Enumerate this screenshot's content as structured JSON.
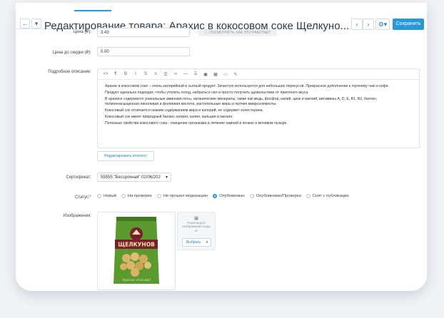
{
  "header": {
    "title": "Редактирование товара: Арахис в кокосовом соке Щелкуно...",
    "back_icon": "back-arrow-icon",
    "menu_icon": "chevron-down-icon",
    "save_label": "Сохранить"
  },
  "form": {
    "price_label": "Цена (₽):",
    "price_value": "3.43",
    "price_hint": "ПОСМОТРЕТЬ, КАК ЭТО РАБОТАЕТ",
    "old_price_label": "Цена до скидки (₽):",
    "old_price_value": "0.00",
    "description_label": "Подробное описание:",
    "toolbar_icons": [
      "<>",
      "¶",
      "B",
      "I",
      "S",
      "≡",
      "☰",
      "∞",
      "—",
      "⌸",
      "▣",
      "▦",
      "▭",
      "✎"
    ],
    "description_lines": [
      "Арахис в кокосовом соке – очень калорийный и сытный продукт. Зачастую используется для небольших перекусов. Прекрасное дополнение к горячему чаю и кофе.",
      "Продукт идеально подходит, чтобы утолить голод, набраться сил и просто получить удовольствие от приятного вкуса.",
      "В арахисе содержатся уникальные аминокислоты, органические минералы, такие как медь, фосфор, калий, цинк и магний, витамины А, D, E, B1, B2, биотин, полиненасыщенная линолевая и фолиевая кислота, растительные жиры и прочие микроэлементы.",
      "Кокосовый сок отличается низким содержанием жира и калорий, не содержит холестерина.",
      "Кокосовый сок имеет природный баланс натрия, калия, кальция и магния.",
      "Полезные свойства кокосового сока - очищение организма и лечение камней в почках и мочевом пузыре."
    ],
    "edit_content_label": "Редактировать контент",
    "certificate_label": "Сертификат:",
    "certificate_value": "55555 \"Бессрочная\" 02/06/202",
    "status_label": "Статус:",
    "status_required": "*",
    "status_options": [
      "Новый",
      "На проверке",
      "Не прошел модерацию",
      "Опубликован",
      "Опубликован/Проверка",
      "Снят с публикации"
    ],
    "status_selected": 3,
    "images_label": "Изображения:",
    "dropzone_text": "Перетащите изображения сюда",
    "dropzone_suffix": "ar",
    "pick_label": "Выбрать"
  },
  "product_image": {
    "brand": "ЩЕЛКУНОВ",
    "tagline": "Арахис для вас",
    "bag_color": "#5a9a2e",
    "band_color": "#7a1e2a"
  }
}
